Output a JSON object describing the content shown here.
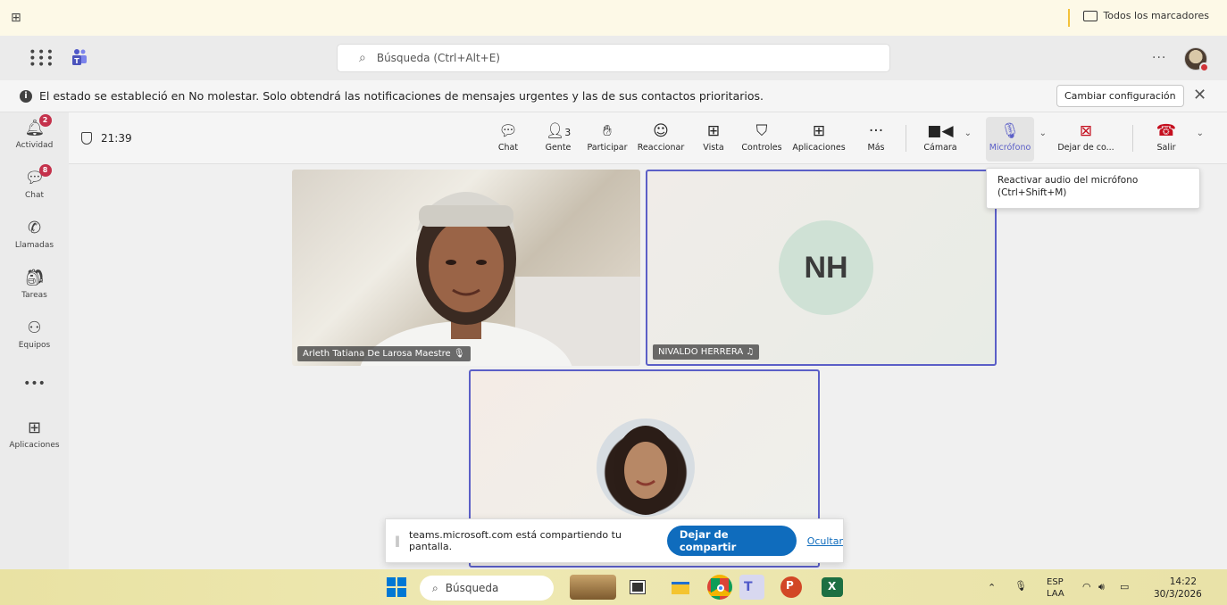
{
  "bookmarks": {
    "folder_label": "Todos los marcadores"
  },
  "header": {
    "search_placeholder": "Búsqueda (Ctrl+Alt+E)",
    "more": "···"
  },
  "notification": {
    "text": "El estado se estableció en No molestar. Solo obtendrá las notificaciones de mensajes urgentes y las de sus contactos prioritarios.",
    "button": "Cambiar configuración",
    "close": "✕"
  },
  "rail": {
    "items": [
      {
        "label": "Actividad",
        "icon": "bell-icon",
        "badge": "2"
      },
      {
        "label": "Chat",
        "icon": "chat-icon",
        "badge": "8"
      },
      {
        "label": "Llamadas",
        "icon": "phone-icon"
      },
      {
        "label": "Tareas",
        "icon": "tasks-icon"
      },
      {
        "label": "Equipos",
        "icon": "teams-icon"
      },
      {
        "label": "",
        "icon": "more-icon"
      },
      {
        "label": "Aplicaciones",
        "icon": "add-icon"
      }
    ]
  },
  "meeting": {
    "timer": "21:39",
    "toolbar": {
      "chat": "Chat",
      "people": "Gente",
      "people_count": "3",
      "raise": "Participar",
      "react": "Reaccionar",
      "view": "Vista",
      "controls": "Controles",
      "apps": "Aplicaciones",
      "more": "Más",
      "camera": "Cámara",
      "mic": "Micrófono",
      "stop_share": "Dejar de co...",
      "leave": "Salir"
    },
    "tooltip_line1": "Reactivar audio del micrófono",
    "tooltip_line2": "(Ctrl+Shift+M)"
  },
  "participants": [
    {
      "name": "Arleth Tatiana De Larosa Maestre"
    },
    {
      "name": "NIVALDO HERRERA",
      "initials": "NH"
    },
    {
      "name": ""
    }
  ],
  "share_bar": {
    "text": "teams.microsoft.com está compartiendo tu pantalla.",
    "stop": "Dejar de compartir",
    "hide": "Ocultar"
  },
  "taskbar": {
    "search": "Búsqueda",
    "lang_top": "ESP",
    "lang_bottom": "LAA",
    "time": "14:22",
    "date": "30/3/2026"
  },
  "colors": {
    "accent": "#5b5fc7",
    "share_button": "#0f6cbd",
    "badge": "#c4314b",
    "leave": "#c50f1f"
  }
}
